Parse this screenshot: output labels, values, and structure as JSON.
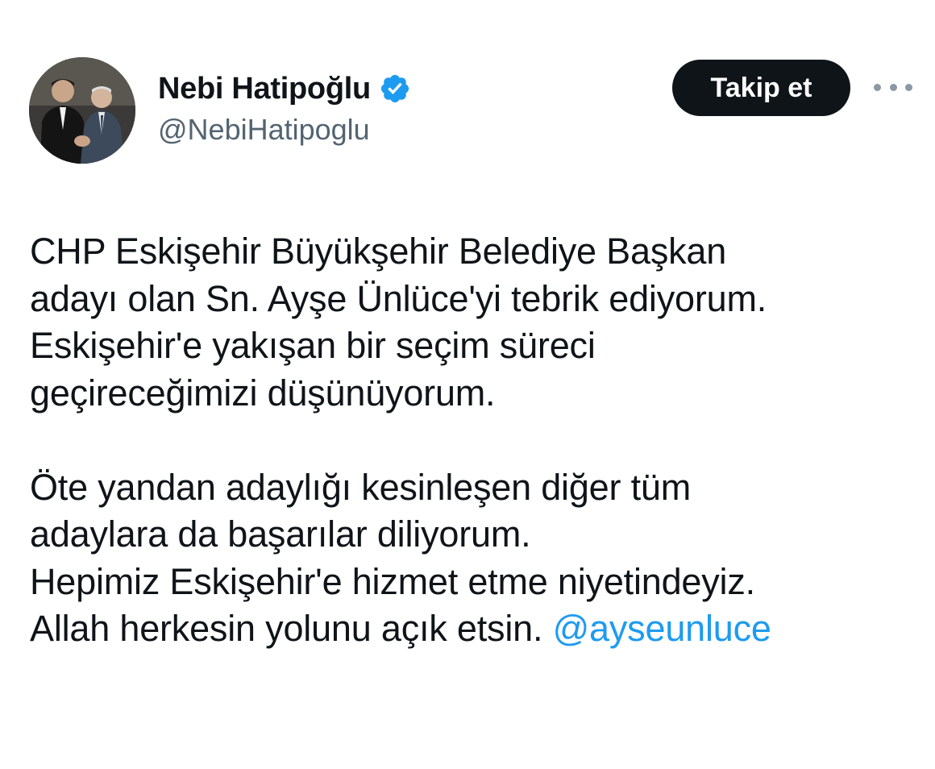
{
  "author": {
    "display_name": "Nebi Hatipoğlu",
    "handle": "@NebiHatipoglu",
    "verified_icon": "verified-badge-icon",
    "avatar_icon": "profile-photo"
  },
  "actions": {
    "follow_label": "Takip et",
    "more_icon": "more-horizontal-icon"
  },
  "tweet": {
    "paragraph1": [
      "CHP Eskişehir Büyükşehir Belediye Başkan",
      "adayı olan Sn. Ayşe Ünlüce'yi tebrik ediyorum.",
      "Eskişehir'e yakışan bir seçim süreci",
      "geçireceğimizi düşünüyorum."
    ],
    "paragraph2": [
      "Öte yandan adaylığı kesinleşen diğer tüm",
      "adaylara da başarılar diliyorum.",
      "Hepimiz Eskişehir'e hizmet etme niyetindeyiz."
    ],
    "last_line_text": "Allah herkesin yolunu açık etsin.",
    "mention": "@ayseunluce"
  },
  "colors": {
    "text": "#0f1419",
    "secondary": "#536471",
    "link": "#1d9bf0",
    "verified": "#1d9bf0",
    "button_bg": "#0f1419"
  }
}
